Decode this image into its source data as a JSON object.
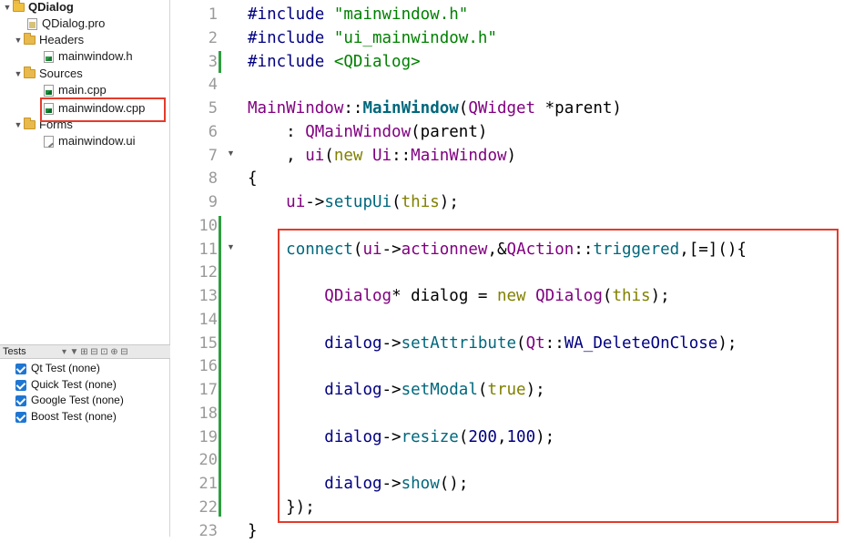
{
  "tree": {
    "project": "QDialog",
    "items": [
      {
        "label": "QDialog.pro"
      },
      {
        "label": "Headers"
      },
      {
        "label": "mainwindow.h"
      },
      {
        "label": "Sources"
      },
      {
        "label": "main.cpp"
      },
      {
        "label": "mainwindow.cpp"
      },
      {
        "label": "Forms"
      },
      {
        "label": "mainwindow.ui"
      }
    ]
  },
  "tests": {
    "title": "Tests",
    "items": [
      {
        "label": "Qt Test (none)"
      },
      {
        "label": "Quick Test (none)"
      },
      {
        "label": "Google Test (none)"
      },
      {
        "label": "Boost Test (none)"
      }
    ]
  },
  "editor": {
    "line_numbers": [
      "1",
      "2",
      "3",
      "4",
      "5",
      "6",
      "7",
      "8",
      "9",
      "10",
      "11",
      "12",
      "13",
      "14",
      "15",
      "16",
      "17",
      "18",
      "19",
      "20",
      "21",
      "22",
      "23"
    ],
    "lines": [
      [
        [
          "pp",
          "#include "
        ],
        [
          "str",
          "\"mainwindow.h\""
        ]
      ],
      [
        [
          "pp",
          "#include "
        ],
        [
          "str",
          "\"ui_mainwindow.h\""
        ]
      ],
      [
        [
          "pp",
          "#include "
        ],
        [
          "str",
          "<QDialog>"
        ]
      ],
      [],
      [
        [
          "cls",
          "MainWindow"
        ],
        [
          "op",
          "::"
        ],
        [
          "fnb",
          "MainWindow"
        ],
        [
          "op",
          "("
        ],
        [
          "cls",
          "QWidget"
        ],
        [
          "op",
          " *parent)"
        ]
      ],
      [
        [
          "op",
          "    : "
        ],
        [
          "cls",
          "QMainWindow"
        ],
        [
          "op",
          "(parent)"
        ]
      ],
      [
        [
          "op",
          "    , "
        ],
        [
          "cls",
          "ui"
        ],
        [
          "op",
          "("
        ],
        [
          "kw",
          "new"
        ],
        [
          "op",
          " "
        ],
        [
          "cls",
          "Ui"
        ],
        [
          "op",
          "::"
        ],
        [
          "cls",
          "MainWindow"
        ],
        [
          "op",
          ")"
        ]
      ],
      [
        [
          "op",
          "{"
        ]
      ],
      [
        [
          "op",
          "    "
        ],
        [
          "cls",
          "ui"
        ],
        [
          "op",
          "->"
        ],
        [
          "fn",
          "setupUi"
        ],
        [
          "op",
          "("
        ],
        [
          "kw",
          "this"
        ],
        [
          "op",
          ");"
        ]
      ],
      [],
      [
        [
          "op",
          "    "
        ],
        [
          "fn",
          "connect"
        ],
        [
          "op",
          "("
        ],
        [
          "cls",
          "ui"
        ],
        [
          "op",
          "->"
        ],
        [
          "cls",
          "actionnew"
        ],
        [
          "op",
          ",&"
        ],
        [
          "cls",
          "QAction"
        ],
        [
          "op",
          "::"
        ],
        [
          "fn",
          "triggered"
        ],
        [
          "op",
          ",[=](){"
        ]
      ],
      [],
      [
        [
          "op",
          "        "
        ],
        [
          "cls",
          "QDialog"
        ],
        [
          "op",
          "* dialog = "
        ],
        [
          "kw",
          "new"
        ],
        [
          "op",
          " "
        ],
        [
          "cls",
          "QDialog"
        ],
        [
          "op",
          "("
        ],
        [
          "kw",
          "this"
        ],
        [
          "op",
          ");"
        ]
      ],
      [],
      [
        [
          "op",
          "        "
        ],
        [
          "mac",
          "dialog"
        ],
        [
          "op",
          "->"
        ],
        [
          "fn",
          "setAttribute"
        ],
        [
          "op",
          "("
        ],
        [
          "cls",
          "Qt"
        ],
        [
          "op",
          "::"
        ],
        [
          "mac",
          "WA_DeleteOnClose"
        ],
        [
          "op",
          ");"
        ]
      ],
      [],
      [
        [
          "op",
          "        "
        ],
        [
          "mac",
          "dialog"
        ],
        [
          "op",
          "->"
        ],
        [
          "fn",
          "setModal"
        ],
        [
          "op",
          "("
        ],
        [
          "kw",
          "true"
        ],
        [
          "op",
          ");"
        ]
      ],
      [],
      [
        [
          "op",
          "        "
        ],
        [
          "mac",
          "dialog"
        ],
        [
          "op",
          "->"
        ],
        [
          "fn",
          "resize"
        ],
        [
          "op",
          "("
        ],
        [
          "num",
          "200"
        ],
        [
          "op",
          ","
        ],
        [
          "num",
          "100"
        ],
        [
          "op",
          ");"
        ]
      ],
      [],
      [
        [
          "op",
          "        "
        ],
        [
          "mac",
          "dialog"
        ],
        [
          "op",
          "->"
        ],
        [
          "fn",
          "show"
        ],
        [
          "op",
          "();"
        ]
      ],
      [
        [
          "op",
          "    });"
        ]
      ],
      [
        [
          "op",
          "}"
        ]
      ]
    ]
  },
  "colors": {
    "highlight": "#e53a2a",
    "change_bar": "#2e9e3f",
    "checkbox": "#1e76d2"
  }
}
